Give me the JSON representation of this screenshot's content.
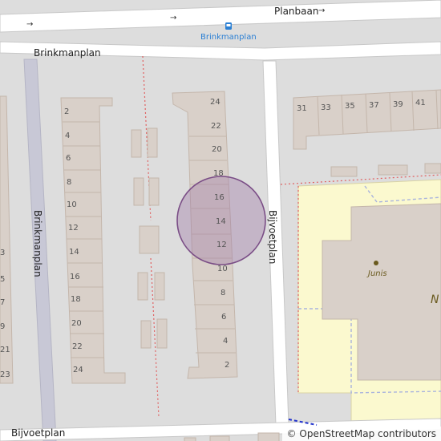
{
  "streets": {
    "planbaan": "Planbaan",
    "brinkmanplan_top": "Brinkmanplan",
    "brinkmanplan_vertical": "Brinkmanplan",
    "bijvoetplan_vertical": "Bijvoetplan",
    "bijvoetplan_bottom": "Bijvoetplan"
  },
  "bus_stop": {
    "label": "Brinkmanplan",
    "icon": "bus-stop-icon",
    "color": "#2a7fd4"
  },
  "poi": {
    "junis_label": "Junis",
    "partial_label": "N"
  },
  "house_numbers": {
    "left_column": [
      "2",
      "4",
      "6",
      "8",
      "10",
      "12",
      "14",
      "16",
      "18",
      "20",
      "22",
      "24"
    ],
    "edge_column": [
      "",
      "3",
      "5",
      "7",
      "9",
      "21",
      "23"
    ],
    "middle_column": [
      "24",
      "22",
      "20",
      "18",
      "16",
      "14",
      "12",
      "10",
      "8",
      "6",
      "4",
      "2"
    ],
    "right_row": [
      "31",
      "33",
      "35",
      "37",
      "39",
      "41"
    ]
  },
  "highlight": {
    "color": "#a07aa8",
    "stroke": "#7a4d86"
  },
  "attribution": {
    "symbol": "©",
    "text": "OpenStreetMap contributors"
  },
  "colors": {
    "background": "#dddddd",
    "building": "#d9d0c9",
    "building_stroke": "#c4b6ab",
    "road": "#ffffff",
    "school_area": "#fbf9cf",
    "path_red": "#e06060",
    "footway": "#aab4dd"
  }
}
